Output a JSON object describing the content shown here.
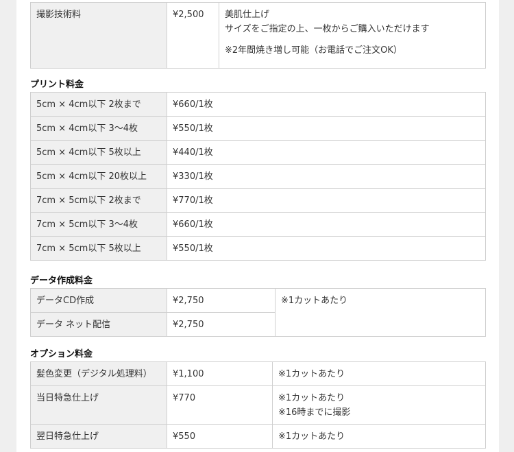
{
  "shooting": {
    "label": "撮影技術料",
    "price": "¥2,500",
    "note_lines": [
      "美肌仕上げ",
      "サイズをご指定の上、一枚からご購入いただけます"
    ],
    "note_extra": "※2年間焼き増し可能（お電話でご注文OK）"
  },
  "print": {
    "heading": "プリント料金",
    "rows": [
      {
        "label": "5cm × 4cm以下 2枚まで",
        "price": "¥660/1枚"
      },
      {
        "label": "5cm × 4cm以下 3〜4枚",
        "price": "¥550/1枚"
      },
      {
        "label": "5cm × 4cm以下 5枚以上",
        "price": "¥440/1枚"
      },
      {
        "label": "5cm × 4cm以下 20枚以上",
        "price": "¥330/1枚"
      },
      {
        "label": "7cm × 5cm以下 2枚まで",
        "price": "¥770/1枚"
      },
      {
        "label": "7cm × 5cm以下 3〜4枚",
        "price": "¥660/1枚"
      },
      {
        "label": "7cm × 5cm以下 5枚以上",
        "price": "¥550/1枚"
      }
    ]
  },
  "data_fee": {
    "heading": "データ作成料金",
    "rows": [
      {
        "label": "データCD作成",
        "price": "¥2,750"
      },
      {
        "label": "データ ネット配信",
        "price": "¥2,750"
      }
    ],
    "note": "※1カットあたり"
  },
  "options": {
    "heading": "オプション料金",
    "rows": [
      {
        "label": "髪色変更（デジタル処理料）",
        "price": "¥1,100",
        "note_lines": [
          "※1カットあたり"
        ]
      },
      {
        "label": "当日特急仕上げ",
        "price": "¥770",
        "note_lines": [
          "※1カットあたり",
          "※16時までに撮影"
        ]
      },
      {
        "label": "翌日特急仕上げ",
        "price": "¥550",
        "note_lines": [
          "※1カットあたり"
        ]
      }
    ]
  }
}
